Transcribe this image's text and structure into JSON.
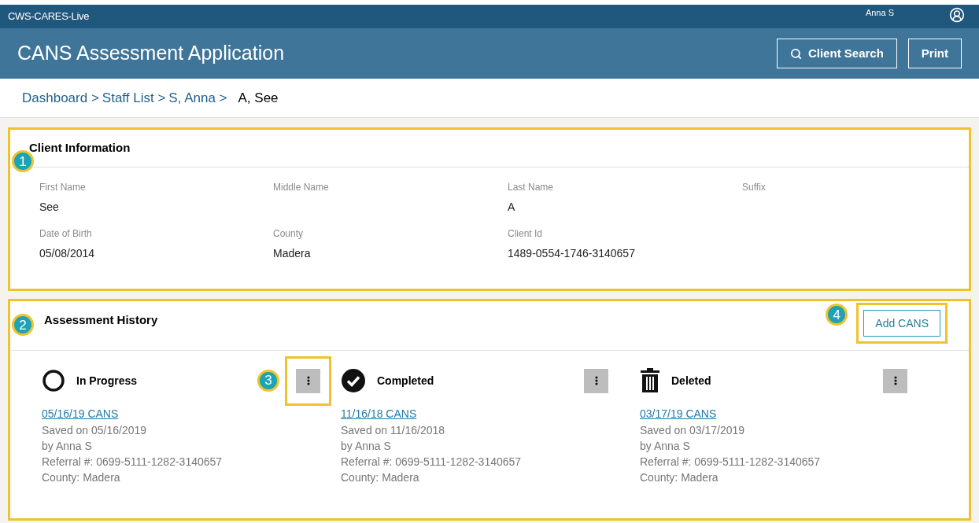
{
  "top_bar": {
    "app_name": "CWS-CARES-Live",
    "user": "Anna S"
  },
  "header": {
    "title": "CANS Assessment Application",
    "buttons": [
      {
        "kind": "search",
        "label": "Client Search"
      },
      {
        "kind": "plain",
        "label": "Print"
      }
    ]
  },
  "breadcrumb": {
    "links": [
      "Dashboard >",
      "Staff List >",
      "S, Anna >"
    ],
    "current": "A, See"
  },
  "client_information": {
    "callout": "1",
    "title": "Client Information",
    "fields": [
      {
        "label": "First Name",
        "value": "See"
      },
      {
        "label": "Middle Name"
      },
      {
        "label": "Last Name",
        "value": "A"
      },
      {
        "label": "Suffix"
      },
      {
        "label": "Date of Birth",
        "value": "05/08/2014"
      },
      {
        "label": "County",
        "value": "Madera"
      },
      {
        "label": "Client Id",
        "value": "1489-0554-1746-3140657"
      }
    ]
  },
  "assessment_history": {
    "callout": "2",
    "title": "Assessment History",
    "add_button": {
      "label": "Add CANS",
      "callout": "4"
    },
    "assessments": [
      {
        "kind": "in_progress",
        "status": "In Progress",
        "menu_callout": "3",
        "link": "05/16/19 CANS",
        "lines": [
          "Saved on 05/16/2019",
          "by Anna S",
          "Referral #: 0699-5111-1282-3140657",
          "County: Madera"
        ]
      },
      {
        "kind": "completed",
        "status": "Completed",
        "link": "11/16/18 CANS",
        "lines": [
          "Saved on 11/16/2018",
          "by Anna S",
          "Referral #: 0699-5111-1282-3140657",
          "County: Madera"
        ]
      },
      {
        "kind": "deleted",
        "status": "Deleted",
        "link": "03/17/19 CANS",
        "lines": [
          "Saved on 03/17/2019",
          "by Anna S",
          "Referral #: 0699-5111-1282-3140657",
          "County: Madera"
        ]
      }
    ]
  }
}
